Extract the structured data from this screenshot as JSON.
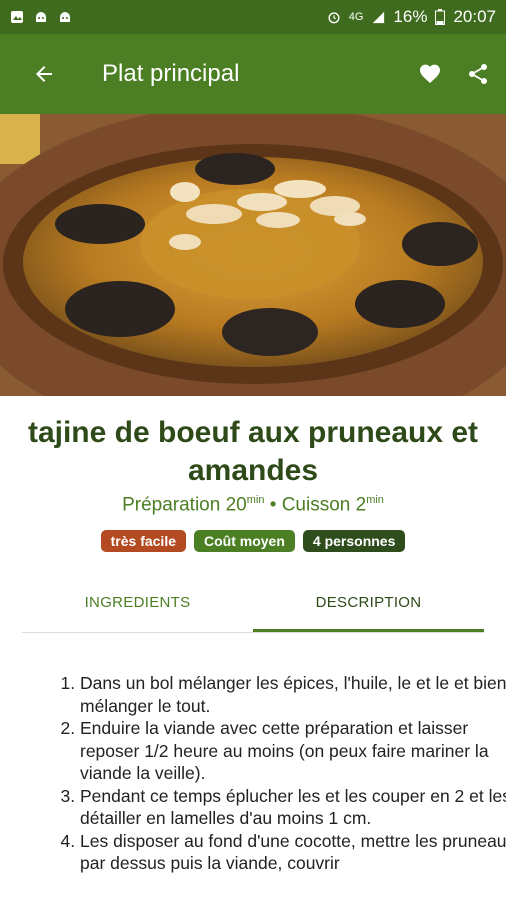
{
  "status_bar": {
    "network": "4G",
    "battery": "16%",
    "time": "20:07",
    "color": "#3f6b1e"
  },
  "app_bar": {
    "title": "Plat principal",
    "color": "#4c7f24"
  },
  "recipe": {
    "title": "tajine de boeuf aux pruneaux et amandes",
    "prep_label": "Préparation 20",
    "prep_unit": "min",
    "separator": "•",
    "cook_label": "Cuisson 2",
    "cook_unit": "min",
    "badges": [
      {
        "label": "très facile",
        "color": "#b34a22"
      },
      {
        "label": "Coût moyen",
        "color": "#4c7f24"
      },
      {
        "label": "4 personnes",
        "color": "#2f4d1c"
      }
    ]
  },
  "tabs": [
    {
      "label": "INGREDIENTS",
      "active": false
    },
    {
      "label": "DESCRIPTION",
      "active": true
    }
  ],
  "steps": [
    "Dans un bol mélanger les épices, l'huile, le et le et bien mélanger le tout.",
    "Enduire la viande avec cette préparation et laisser reposer 1/2 heure au moins (on peux faire mariner la viande la veille).",
    "Pendant ce temps éplucher les et les couper en 2 et les détailler en lamelles d'au moins 1 cm.",
    "Les disposer au fond d'une cocotte, mettre les pruneaux par dessus puis la viande, couvrir"
  ]
}
